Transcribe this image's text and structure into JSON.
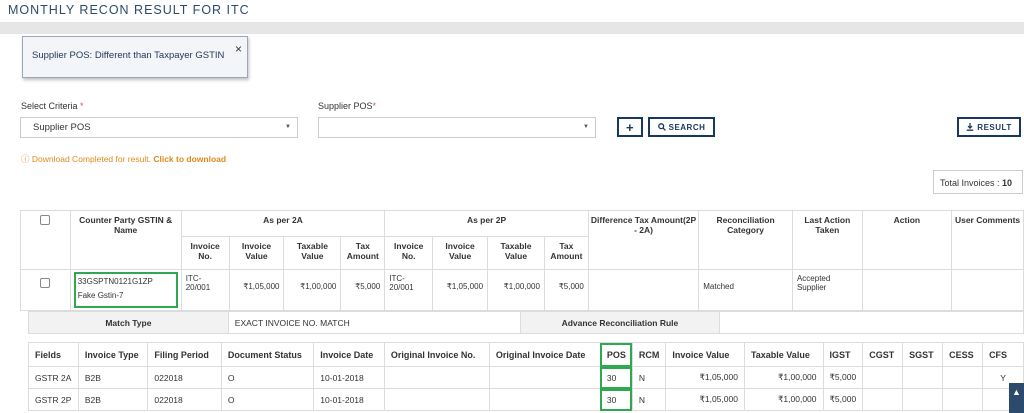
{
  "page": {
    "title": "MONTHLY RECON RESULT FOR ITC"
  },
  "toast": {
    "message": "Supplier POS: Different than Taxpayer GSTIN",
    "close": "×"
  },
  "filters": {
    "criteria_label": "Select Criteria",
    "criteria_required": "*",
    "criteria_value": "Supplier POS",
    "pos_label": "Supplier POS",
    "pos_required": "*",
    "pos_value": ""
  },
  "buttons": {
    "add": "+",
    "search": "SEARCH",
    "result": "RESULT"
  },
  "download": {
    "message": "Download Completed for result.",
    "link": "Click to download"
  },
  "totals": {
    "label": "Total Invoices :",
    "value": "10"
  },
  "table": {
    "headers": {
      "counterparty": "Counter Party GSTIN & Name",
      "as_per_2a": "As per 2A",
      "as_per_2p": "As per 2P",
      "difference": "Difference Tax Amount(2P - 2A)",
      "recon_category": "Reconciliation Category",
      "last_action": "Last Action Taken",
      "action": "Action",
      "user_comments": "User Comments",
      "sub": [
        "Invoice No.",
        "Invoice Value",
        "Taxable Value",
        "Tax Amount"
      ]
    },
    "row": {
      "gstin": "33GSPTN0121G1ZP",
      "name": "Fake Gstin-7",
      "a_invoice_no": "ITC-20/001",
      "a_invoice_value": "₹1,05,000",
      "a_taxable_value": "₹1,00,000",
      "a_tax_amount": "₹5,000",
      "p_invoice_no": "ITC-20/001",
      "p_invoice_value": "₹1,05,000",
      "p_taxable_value": "₹1,00,000",
      "p_tax_amount": "₹5,000",
      "difference": "",
      "recon_category": "Matched",
      "last_action": "Accepted Supplier",
      "action": "",
      "user_comments": ""
    }
  },
  "match": {
    "match_type_label": "Match Type",
    "match_type_value": "EXACT INVOICE NO. MATCH",
    "rule_label": "Advance Reconciliation Rule",
    "rule_value": ""
  },
  "detail": {
    "headers": [
      "Fields",
      "Invoice Type",
      "Filing Period",
      "Document Status",
      "Invoice Date",
      "Original Invoice No.",
      "Original Invoice Date",
      "POS",
      "RCM",
      "Invoice Value",
      "Taxable Value",
      "IGST",
      "CGST",
      "SGST",
      "CESS",
      "CFS"
    ],
    "rows": [
      [
        "GSTR 2A",
        "B2B",
        "022018",
        "O",
        "10-01-2018",
        "",
        "",
        "30",
        "N",
        "₹1,05,000",
        "₹1,00,000",
        "₹5,000",
        "",
        "",
        "",
        "Y"
      ],
      [
        "GSTR 2P",
        "B2B",
        "022018",
        "O",
        "10-01-2018",
        "",
        "",
        "30",
        "N",
        "₹1,05,000",
        "₹1,00,000",
        "₹5,000",
        "",
        "",
        "",
        ""
      ]
    ]
  },
  "colors": {
    "accent": "#17375e",
    "highlight": "#2fa84f",
    "warning": "#e08a1e"
  },
  "icons": {
    "close": "close-icon",
    "plus": "plus-icon",
    "search": "search-icon",
    "download": "download-icon",
    "info": "info-icon",
    "caret": "caret-down-icon",
    "scroll_top": "arrow-up-icon"
  }
}
